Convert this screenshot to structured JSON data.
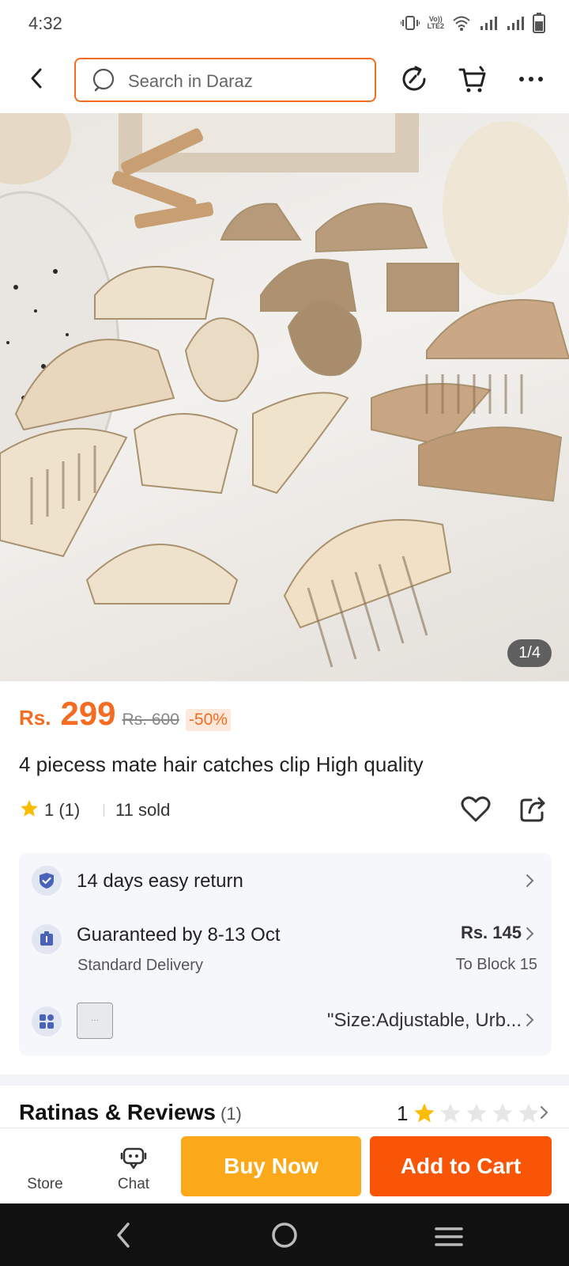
{
  "status_bar": {
    "time": "4:32",
    "icons": [
      "vibrate-icon",
      "volte-icon",
      "wifi-icon",
      "signal-icon",
      "signal-icon",
      "battery-icon"
    ],
    "volte_line1": "Vo))",
    "volte_line2": "LTE2"
  },
  "header": {
    "search_placeholder": "Search in Daraz",
    "icons": [
      "back-icon",
      "search-icon",
      "history-icon",
      "cart-icon",
      "more-icon"
    ]
  },
  "gallery": {
    "counter": "1/4",
    "image": "hair clips photo"
  },
  "product": {
    "currency": "Rs.",
    "price": "299",
    "original_price": "Rs. 600",
    "discount": "-50%",
    "title": "4 piecess mate hair catches clip High quality",
    "rating": "1 (1)",
    "sold": "11 sold"
  },
  "info": {
    "return": {
      "label": "14 days easy return"
    },
    "delivery": {
      "label": "Guaranteed by 8-13 Oct",
      "sub": "Standard Delivery",
      "price": "Rs. 145",
      "location": "To Block 15"
    },
    "variant": {
      "thumb_text": "···",
      "label": "\"Size:Adjustable, Urb..."
    }
  },
  "reviews": {
    "title": "Ratinas & Reviews",
    "count": "(1)",
    "score": "1",
    "stars_filled": 1,
    "stars_total": 5
  },
  "actions": {
    "store": "Store",
    "chat": "Chat",
    "buy_now": "Buy Now",
    "add_to_cart": "Add to Cart"
  },
  "colors": {
    "brand_orange": "#f85606",
    "buy_now_yellow": "#fba91a",
    "price_orange": "#f36c21",
    "star": "#fbbc05"
  }
}
